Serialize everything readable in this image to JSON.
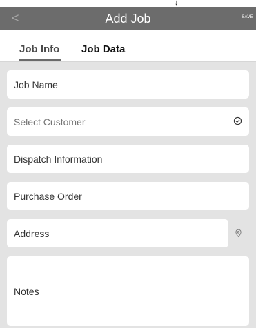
{
  "status": {
    "arrow_icon": "down-arrow-icon"
  },
  "header": {
    "back_label": "<",
    "title": "Add Job",
    "save_label": "SAVE"
  },
  "tabs": [
    {
      "label": "Job Info",
      "active": true
    },
    {
      "label": "Job Data",
      "active": false
    }
  ],
  "form": {
    "job_name": {
      "label": "Job Name"
    },
    "customer": {
      "placeholder": "Select Customer",
      "icon": "check-circle-icon"
    },
    "dispatch": {
      "label": "Dispatch Information"
    },
    "purchase_order": {
      "label": "Purchase Order"
    },
    "address": {
      "label": "Address",
      "icon": "map-pin-icon"
    },
    "notes": {
      "label": "Notes"
    }
  },
  "colors": {
    "header_bg": "#6c6c6c",
    "content_bg": "#e3e3e3",
    "field_bg": "#ffffff"
  }
}
